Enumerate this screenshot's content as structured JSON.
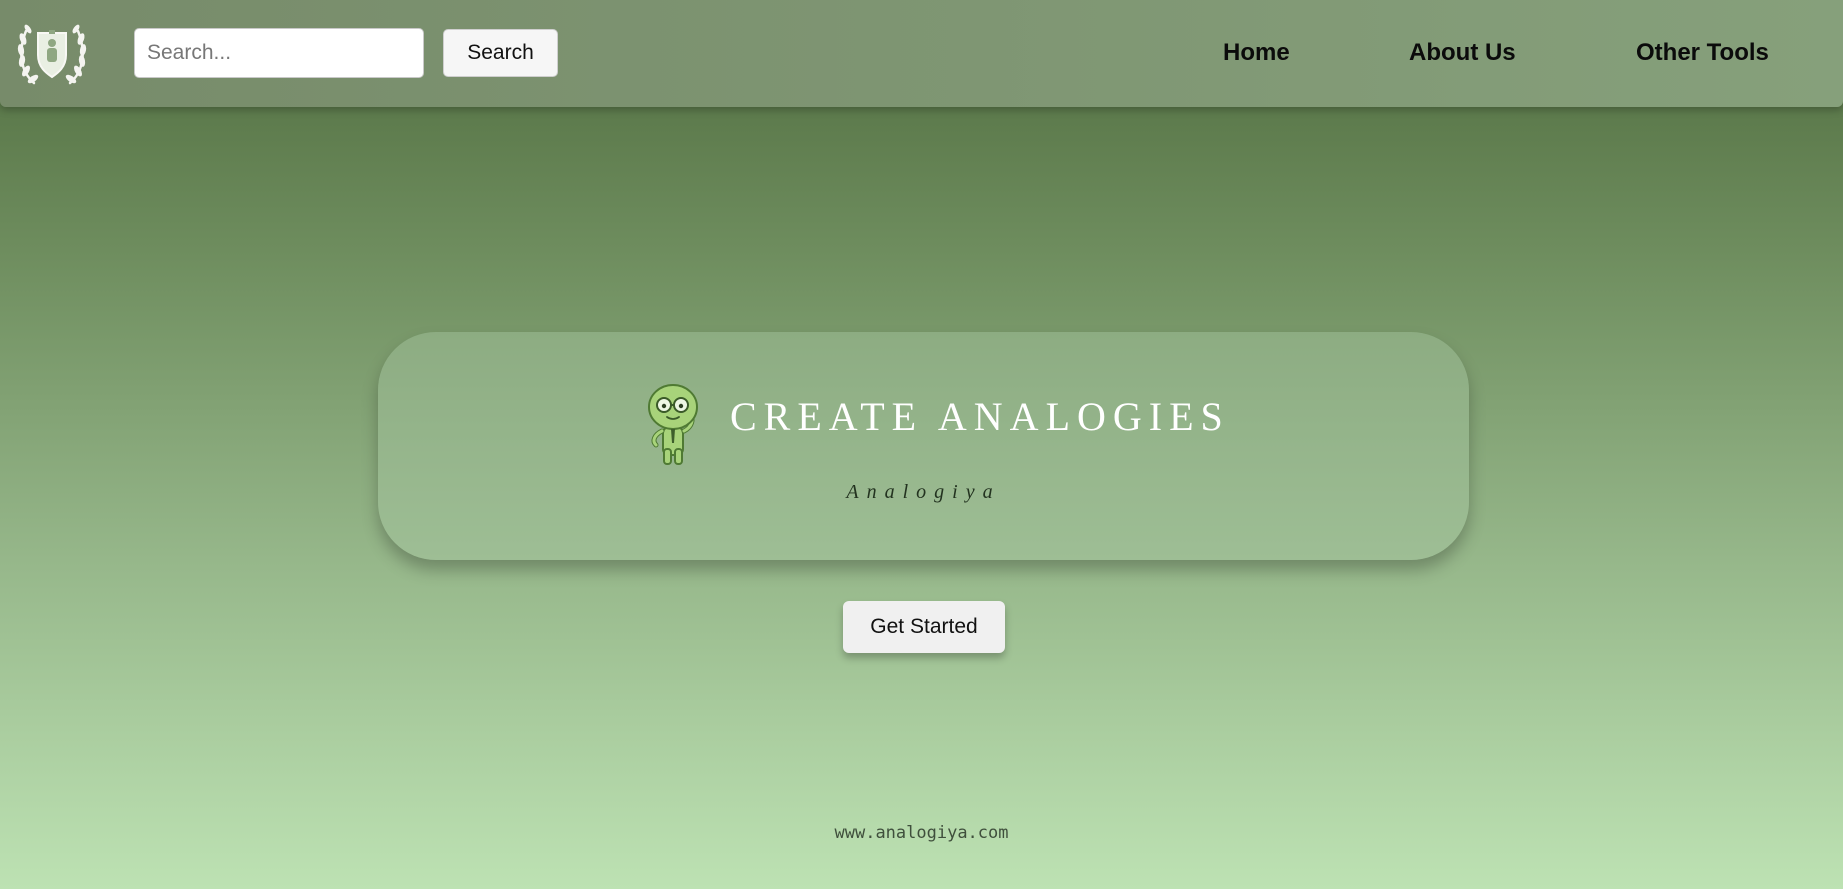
{
  "header": {
    "logo_icon": "laurel-shield-logo-icon",
    "search": {
      "placeholder": "Search...",
      "value": "",
      "button_label": "Search"
    },
    "nav": [
      {
        "label": "Home"
      },
      {
        "label": "About Us"
      },
      {
        "label": "Other Tools"
      }
    ]
  },
  "hero": {
    "mascot_icon": "green-mascot-icon",
    "title": "CREATE ANALOGIES",
    "subtitle": "Analogiya"
  },
  "cta": {
    "label": "Get Started"
  },
  "footer": {
    "url": "www.analogiya.com"
  },
  "colors": {
    "navbar": "#7f9673",
    "background_top": "#4f6c3e",
    "background_bottom": "#bde2b3",
    "card": "#9ab893",
    "title_text": "#ffffff"
  }
}
